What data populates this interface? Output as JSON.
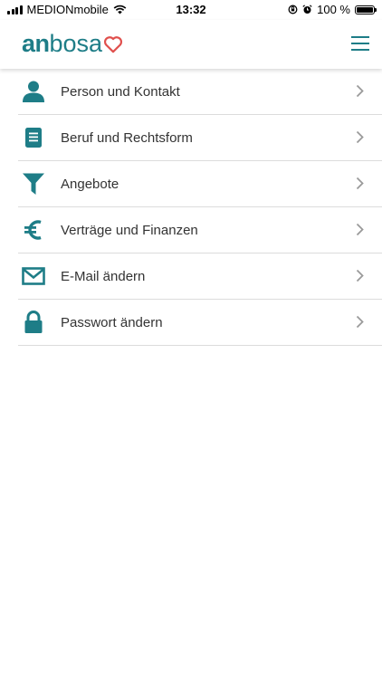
{
  "status_bar": {
    "carrier": "MEDIONmobile",
    "time": "13:32",
    "battery": "100 %"
  },
  "header": {
    "logo_bold": "an",
    "logo_light": "bosa",
    "logo_heart_icon": "heart-outline-icon",
    "menu_icon": "hamburger-icon"
  },
  "colors": {
    "accent": "#1e7d87",
    "heart": "#e0504d",
    "text": "#333333",
    "divider": "#dcdcdc",
    "chevron": "#9a9a9a"
  },
  "menu": {
    "items": [
      {
        "label": "Person und Kontakt",
        "icon": "person-icon"
      },
      {
        "label": "Beruf und Rechtsform",
        "icon": "document-icon"
      },
      {
        "label": "Angebote",
        "icon": "filter-icon"
      },
      {
        "label": "Verträge und Finanzen",
        "icon": "euro-icon"
      },
      {
        "label": "E-Mail ändern",
        "icon": "envelope-icon"
      },
      {
        "label": "Passwort ändern",
        "icon": "lock-icon"
      }
    ]
  }
}
